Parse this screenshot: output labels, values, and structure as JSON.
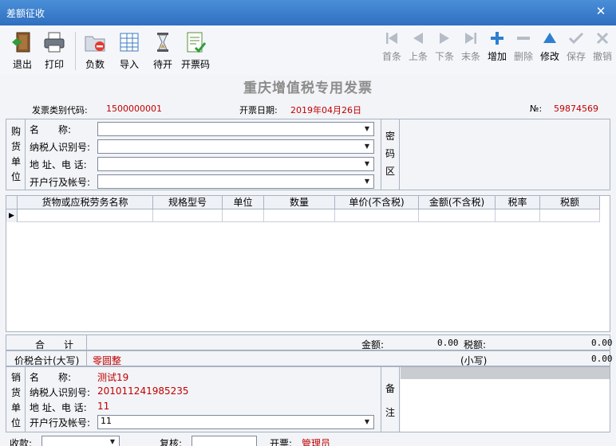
{
  "window": {
    "title": "差额征收",
    "close_glyph": "✕"
  },
  "toolbar": {
    "left": [
      {
        "id": "exit",
        "label": "退出",
        "icon": "exit-door-icon"
      },
      {
        "id": "print",
        "label": "打印",
        "icon": "printer-icon"
      },
      {
        "id": "negative",
        "label": "负数",
        "icon": "negative-folder-icon"
      },
      {
        "id": "import",
        "label": "导入",
        "icon": "import-table-icon"
      },
      {
        "id": "pending",
        "label": "待开",
        "icon": "hourglass-icon"
      },
      {
        "id": "invoice_code",
        "label": "开票码",
        "icon": "invoice-code-icon"
      }
    ],
    "right": [
      {
        "id": "first",
        "label": "首条",
        "icon": "first-record-icon",
        "enabled": false
      },
      {
        "id": "prev",
        "label": "上条",
        "icon": "previous-record-icon",
        "enabled": false
      },
      {
        "id": "next",
        "label": "下条",
        "icon": "next-record-icon",
        "enabled": false
      },
      {
        "id": "last",
        "label": "末条",
        "icon": "last-record-icon",
        "enabled": false
      },
      {
        "id": "add",
        "label": "增加",
        "icon": "plus-icon",
        "enabled": true
      },
      {
        "id": "delete",
        "label": "删除",
        "icon": "minus-icon",
        "enabled": false
      },
      {
        "id": "modify",
        "label": "修改",
        "icon": "modify-triangle-icon",
        "enabled": true
      },
      {
        "id": "save",
        "label": "保存",
        "icon": "checkmark-icon",
        "enabled": false
      },
      {
        "id": "cancel",
        "label": "撤销",
        "icon": "cross-icon",
        "enabled": false
      }
    ]
  },
  "invoice": {
    "title": "重庆增值税专用发票",
    "type_code_label": "发票类别代码:",
    "type_code": "1500000001",
    "date_label": "开票日期:",
    "date": "2019年04月26日",
    "number_label": "№:",
    "number": "59874569"
  },
  "buyer": {
    "section_label": [
      "购",
      "货",
      "单",
      "位"
    ],
    "fields": [
      {
        "label": "名　　称:",
        "value": ""
      },
      {
        "label": "纳税人识别号:",
        "value": ""
      },
      {
        "label": "地 址、电 话:",
        "value": ""
      },
      {
        "label": "开户行及帐号:",
        "value": ""
      }
    ],
    "cipher_label": [
      "密",
      "码",
      "区"
    ]
  },
  "items_grid": {
    "columns": [
      "货物或应税劳务名称",
      "规格型号",
      "单位",
      "数量",
      "单价(不含税)",
      "金额(不含税)",
      "税率",
      "税额"
    ],
    "row_indicator": "▶"
  },
  "totals": {
    "total_label": "合　　计",
    "amount_label": "金额:",
    "amount": "0.00",
    "tax_label": "税额:",
    "tax": "0.00",
    "in_words_label": "价税合计(大写)",
    "in_words": "零圆整",
    "small_label": "(小写)",
    "small": "0.00"
  },
  "seller": {
    "section_label": [
      "销",
      "货",
      "单",
      "位"
    ],
    "name_label": "名　　称:",
    "name": "测试19",
    "tax_id_label": "纳税人识别号:",
    "tax_id": "201011241985235",
    "address_label": "地 址、电 话:",
    "address": "11",
    "bank_label": "开户行及帐号:",
    "bank": "11",
    "remark_label": [
      "备",
      "注"
    ]
  },
  "footer": {
    "payee_label": "收款:",
    "reviewer_label": "复核:",
    "issuer_label": "开票:",
    "issuer": "管理员"
  }
}
